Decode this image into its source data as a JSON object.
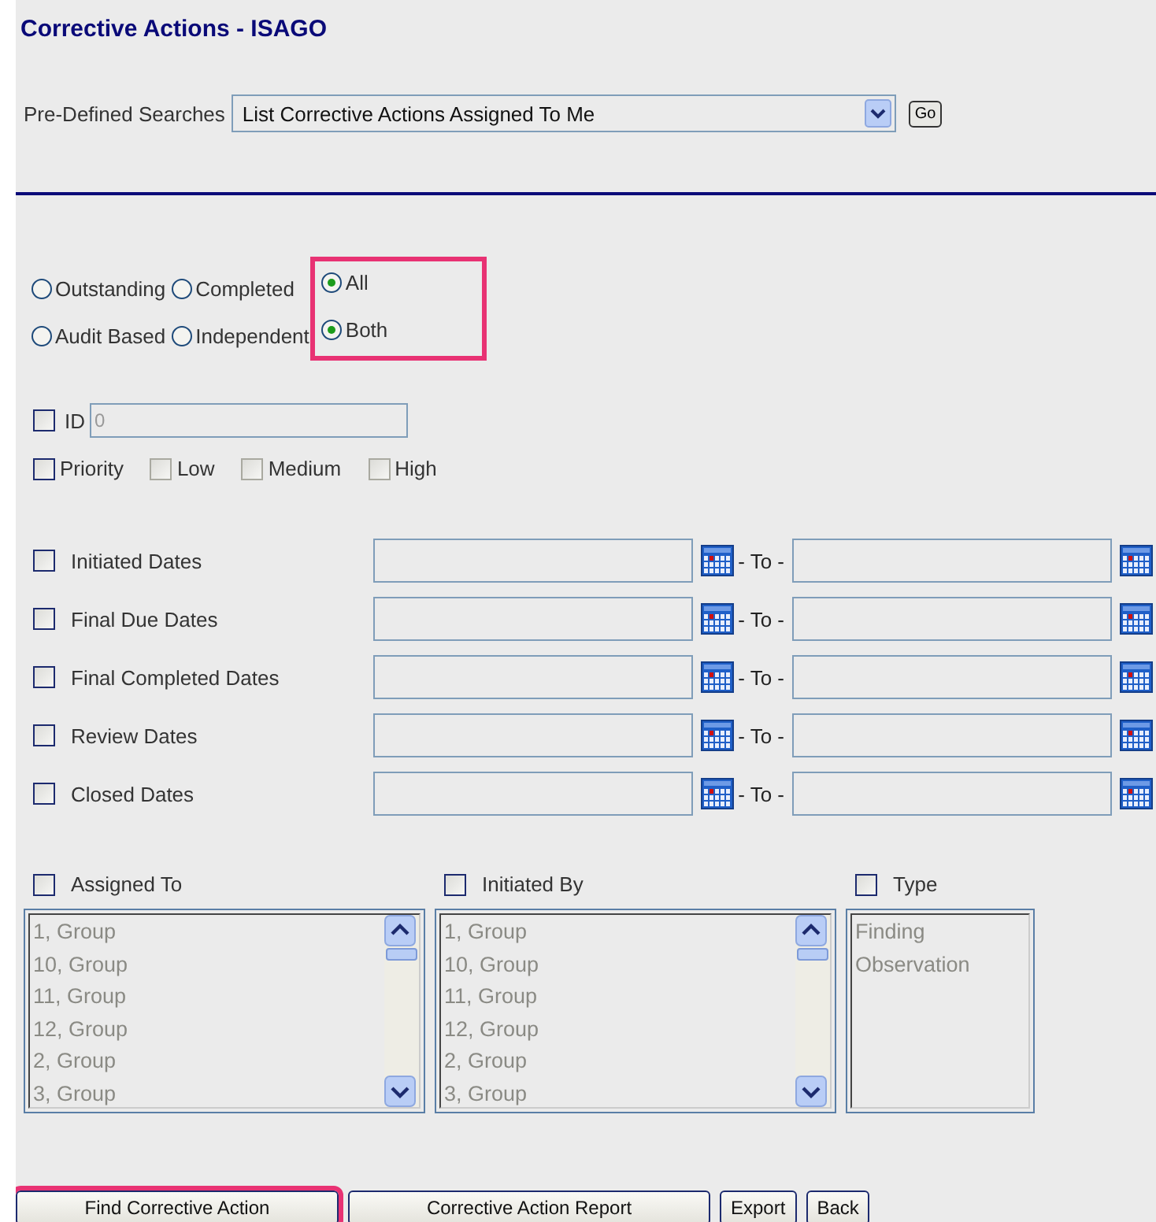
{
  "title": "Corrective Actions - ISAGO",
  "predefined": {
    "label": "Pre-Defined Searches",
    "value": "List Corrective Actions Assigned To Me",
    "go": "Go"
  },
  "radio_columns": [
    {
      "highlighted": false,
      "options": [
        {
          "label": "Outstanding",
          "selected": false
        },
        {
          "label": "Audit Based",
          "selected": false
        }
      ]
    },
    {
      "highlighted": false,
      "options": [
        {
          "label": "Completed",
          "selected": false
        },
        {
          "label": "Independent",
          "selected": false
        }
      ]
    },
    {
      "highlighted": true,
      "options": [
        {
          "label": "All",
          "selected": true
        },
        {
          "label": "Both",
          "selected": true
        }
      ]
    }
  ],
  "id_filter": {
    "label": "ID",
    "checked": false,
    "value": "0",
    "disabled": true
  },
  "priority": {
    "label": "Priority",
    "checked": false,
    "levels": [
      {
        "label": "Low",
        "checked": false,
        "disabled": true
      },
      {
        "label": "Medium",
        "checked": false,
        "disabled": true
      },
      {
        "label": "High",
        "checked": false,
        "disabled": true
      }
    ]
  },
  "date_filters": [
    {
      "label": "Initiated Dates",
      "checked": false,
      "separator": "- To -"
    },
    {
      "label": "Final Due Dates",
      "checked": false,
      "separator": "- To -"
    },
    {
      "label": "Final Completed Dates",
      "checked": false,
      "separator": "- To -"
    },
    {
      "label": "Review Dates",
      "checked": false,
      "separator": "- To -"
    },
    {
      "label": "Closed Dates",
      "checked": false,
      "separator": "- To -"
    }
  ],
  "lists": [
    {
      "label": "Assigned To",
      "checked": false,
      "disabled": true,
      "scrollable": true,
      "items": [
        "1, Group",
        "10, Group",
        "11, Group",
        "12, Group",
        "2, Group",
        "3, Group"
      ]
    },
    {
      "label": "Initiated By",
      "checked": false,
      "disabled": true,
      "scrollable": true,
      "items": [
        "1, Group",
        "10, Group",
        "11, Group",
        "12, Group",
        "2, Group",
        "3, Group"
      ]
    },
    {
      "label": "Type",
      "checked": false,
      "disabled": true,
      "scrollable": false,
      "items": [
        "Finding",
        "Observation"
      ]
    }
  ],
  "buttons": [
    {
      "label": "Find Corrective Action",
      "highlighted": true
    },
    {
      "label": "Corrective Action Report",
      "highlighted": false
    },
    {
      "label": "Export",
      "highlighted": false
    },
    {
      "label": "Back",
      "highlighted": false
    }
  ]
}
